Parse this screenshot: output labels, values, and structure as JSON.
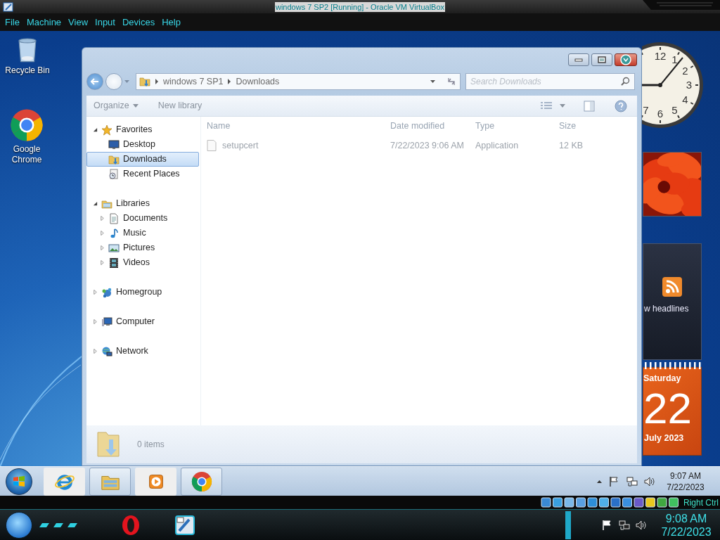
{
  "host_window": {
    "title": "windows 7 SP2 [Running] - Oracle VM VirtualBox"
  },
  "host_menu": [
    "File",
    "Machine",
    "View",
    "Input",
    "Devices",
    "Help"
  ],
  "desktop_icons": [
    {
      "label": "Recycle Bin",
      "kind": "bin"
    },
    {
      "label": "Google Chrome",
      "kind": "chrome"
    }
  ],
  "explorer": {
    "breadcrumb": [
      "windows 7 SP1",
      "Downloads"
    ],
    "search": {
      "placeholder": "Search Downloads"
    },
    "commands": [
      {
        "label": "Organize",
        "dropdown": true
      },
      {
        "label": "New library",
        "dropdown": false
      }
    ],
    "nav": [
      {
        "label": "Favorites",
        "kind": "star",
        "expanded": true,
        "selected": false,
        "children": [
          {
            "label": "Desktop",
            "kind": "desktop",
            "selected": false
          },
          {
            "label": "Downloads",
            "kind": "downloads",
            "selected": true
          },
          {
            "label": "Recent Places",
            "kind": "recent",
            "selected": false
          }
        ]
      },
      {
        "label": "Libraries",
        "kind": "library",
        "expanded": true,
        "selected": false,
        "children": [
          {
            "label": "Documents",
            "kind": "document",
            "expanded": false,
            "selected": false
          },
          {
            "label": "Music",
            "kind": "music",
            "expanded": false,
            "selected": false
          },
          {
            "label": "Pictures",
            "kind": "pictures",
            "expanded": false,
            "selected": false
          },
          {
            "label": "Videos",
            "kind": "videos",
            "expanded": false,
            "selected": false
          }
        ]
      },
      {
        "label": "Homegroup",
        "kind": "homegroup",
        "expanded": false,
        "selected": false
      },
      {
        "label": "Computer",
        "kind": "computer",
        "expanded": false,
        "selected": false
      },
      {
        "label": "Network",
        "kind": "network",
        "expanded": false,
        "selected": false
      }
    ],
    "columns": [
      "Name",
      "Date modified",
      "Type",
      "Size"
    ],
    "files": [
      {
        "name": "setupcert",
        "date": "7/22/2023 9:06 AM",
        "type": "Application",
        "size": "12 KB",
        "selected": false
      }
    ],
    "status": "0 items"
  },
  "gadgets": {
    "clock_numerals": [
      "12",
      "1",
      "2",
      "3",
      "4",
      "5",
      "6",
      "7"
    ],
    "feed_text": "w headlines",
    "calendar": {
      "weekday": "Saturday",
      "day": "22",
      "month": "July 2023"
    }
  },
  "guest_taskbar": {
    "apps": [
      {
        "kind": "ie",
        "running": false
      },
      {
        "kind": "explorer",
        "running": true
      },
      {
        "kind": "media",
        "running": false
      },
      {
        "kind": "chrome",
        "running": true
      }
    ],
    "clock": {
      "time": "9:07 AM",
      "date": "7/22/2023"
    }
  },
  "host_status": {
    "key": "Right Ctrl"
  },
  "host_taskbar": {
    "apps": [
      {
        "kind": "opera"
      },
      {
        "kind": "vbox"
      }
    ],
    "clock": {
      "time": "9:08 AM",
      "date": "7/22/2023"
    }
  }
}
